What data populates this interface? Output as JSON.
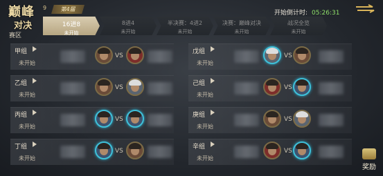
{
  "header": {
    "logo_line1": "巅峰",
    "logo_line2": "对决",
    "logo_num": "9",
    "season": "第4届",
    "saiqu": "赛区",
    "countdown_label": "开始倒计时:",
    "countdown_time": "05:26:31"
  },
  "stages": [
    {
      "name": "16进8",
      "status": "未开始"
    },
    {
      "name": "8进4",
      "status": "未开始"
    },
    {
      "name": "半决赛：4进2",
      "status": "未开始"
    },
    {
      "name": "决赛：巅峰对决",
      "status": "未开始"
    },
    {
      "name": "战况全览",
      "status": "未开始"
    }
  ],
  "groups": [
    {
      "name": "甲组",
      "status": "未开始",
      "vs": "VS"
    },
    {
      "name": "乙组",
      "status": "未开始",
      "vs": "VS"
    },
    {
      "name": "丙组",
      "status": "未开始",
      "vs": "VS"
    },
    {
      "name": "丁组",
      "status": "未开始",
      "vs": "VS"
    },
    {
      "name": "戊组",
      "status": "未开始",
      "vs": "VS"
    },
    {
      "name": "己组",
      "status": "未开始",
      "vs": "VS"
    },
    {
      "name": "庚组",
      "status": "未开始",
      "vs": "VS"
    },
    {
      "name": "辛组",
      "status": "未开始",
      "vs": "VS"
    }
  ],
  "reward_label": "奖励",
  "colors": {
    "active_tab": "#d9ccb0",
    "countdown": "#8fe06a",
    "avatar_ring_cyan": "#3fc0d8",
    "avatar_ring_gold": "#7b6b46"
  }
}
